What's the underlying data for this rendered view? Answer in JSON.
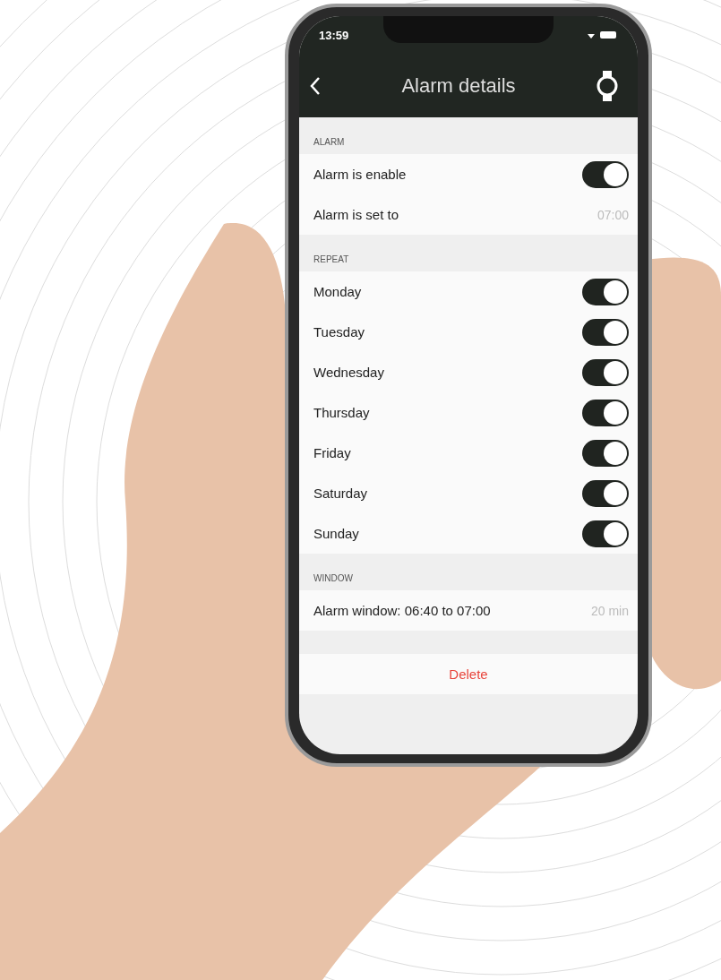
{
  "status_bar": {
    "time": "13:59"
  },
  "nav_bar": {
    "title": "Alarm details"
  },
  "sections": [
    {
      "header": "ALARM",
      "rows": [
        {
          "kind": "toggle",
          "label": "Alarm is enable",
          "on": true
        },
        {
          "kind": "value",
          "label": "Alarm is set to",
          "value": "07:00"
        }
      ]
    },
    {
      "header": "REPEAT",
      "rows": [
        {
          "kind": "toggle",
          "label": "Monday",
          "on": true
        },
        {
          "kind": "toggle",
          "label": "Tuesday",
          "on": true
        },
        {
          "kind": "toggle",
          "label": "Wednesday",
          "on": true
        },
        {
          "kind": "toggle",
          "label": "Thursday",
          "on": true
        },
        {
          "kind": "toggle",
          "label": "Friday",
          "on": true
        },
        {
          "kind": "toggle",
          "label": "Saturday",
          "on": true
        },
        {
          "kind": "toggle",
          "label": "Sunday",
          "on": true
        }
      ]
    },
    {
      "header": "WINDOW",
      "rows": [
        {
          "kind": "value",
          "label": "Alarm window: 06:40 to 07:00",
          "value": "20 min"
        }
      ]
    }
  ],
  "delete_button": "Delete"
}
